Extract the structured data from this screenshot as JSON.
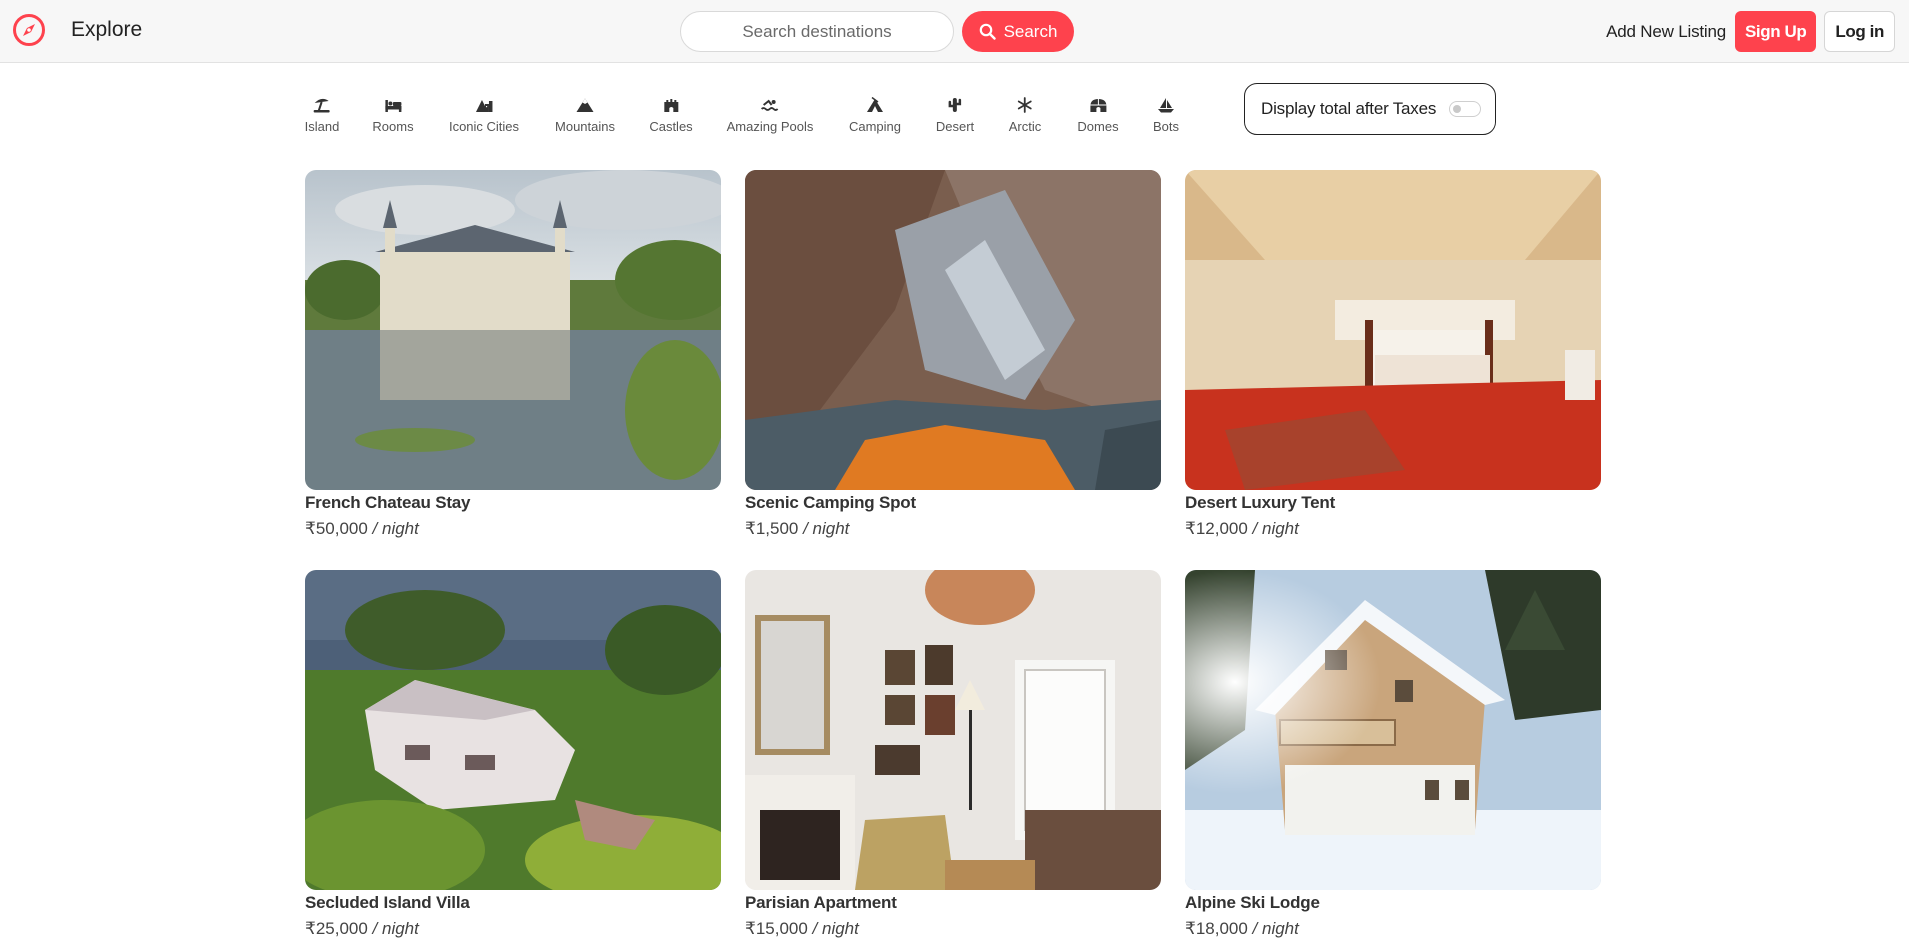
{
  "navbar": {
    "brand_title": "Explore",
    "search_placeholder": "Search destinations",
    "search_button": "Search",
    "add_listing": "Add New Listing",
    "sign_up": "Sign Up",
    "log_in": "Log in"
  },
  "filters": [
    {
      "label": "Island",
      "icon": "umbrella-beach-icon"
    },
    {
      "label": "Rooms",
      "icon": "bed-icon"
    },
    {
      "label": "Iconic Cities",
      "icon": "mountain-city-icon"
    },
    {
      "label": "Mountains",
      "icon": "mountain-icon"
    },
    {
      "label": "Castles",
      "icon": "castle-icon"
    },
    {
      "label": "Amazing Pools",
      "icon": "person-swimming-icon"
    },
    {
      "label": "Camping",
      "icon": "campground-icon"
    },
    {
      "label": "Desert",
      "icon": "cactus-icon"
    },
    {
      "label": "Arctic",
      "icon": "snowflake-icon"
    },
    {
      "label": "Domes",
      "icon": "igloo-icon"
    },
    {
      "label": "Bots",
      "icon": "sailboat-icon"
    }
  ],
  "tax_toggle": {
    "label": "Display total after Taxes",
    "enabled": false
  },
  "listings": [
    {
      "title": "French Chateau Stay",
      "price": "₹50,000",
      "per": "/ night",
      "image": "chateau-photo"
    },
    {
      "title": "Scenic Camping Spot",
      "price": "₹1,500",
      "per": "/ night",
      "image": "mountain-camp-photo"
    },
    {
      "title": "Desert Luxury Tent",
      "price": "₹12,000",
      "per": "/ night",
      "image": "tent-interior-photo"
    },
    {
      "title": "Secluded Island Villa",
      "price": "₹25,000",
      "per": "/ night",
      "image": "island-villa-photo"
    },
    {
      "title": "Parisian Apartment",
      "price": "₹15,000",
      "per": "/ night",
      "image": "apartment-interior-photo"
    },
    {
      "title": "Alpine Ski Lodge",
      "price": "₹18,000",
      "per": "/ night",
      "image": "ski-lodge-photo"
    }
  ],
  "colors": {
    "accent": "#fe424d",
    "text": "#222222",
    "navbar_bg": "#f7f7f7"
  }
}
